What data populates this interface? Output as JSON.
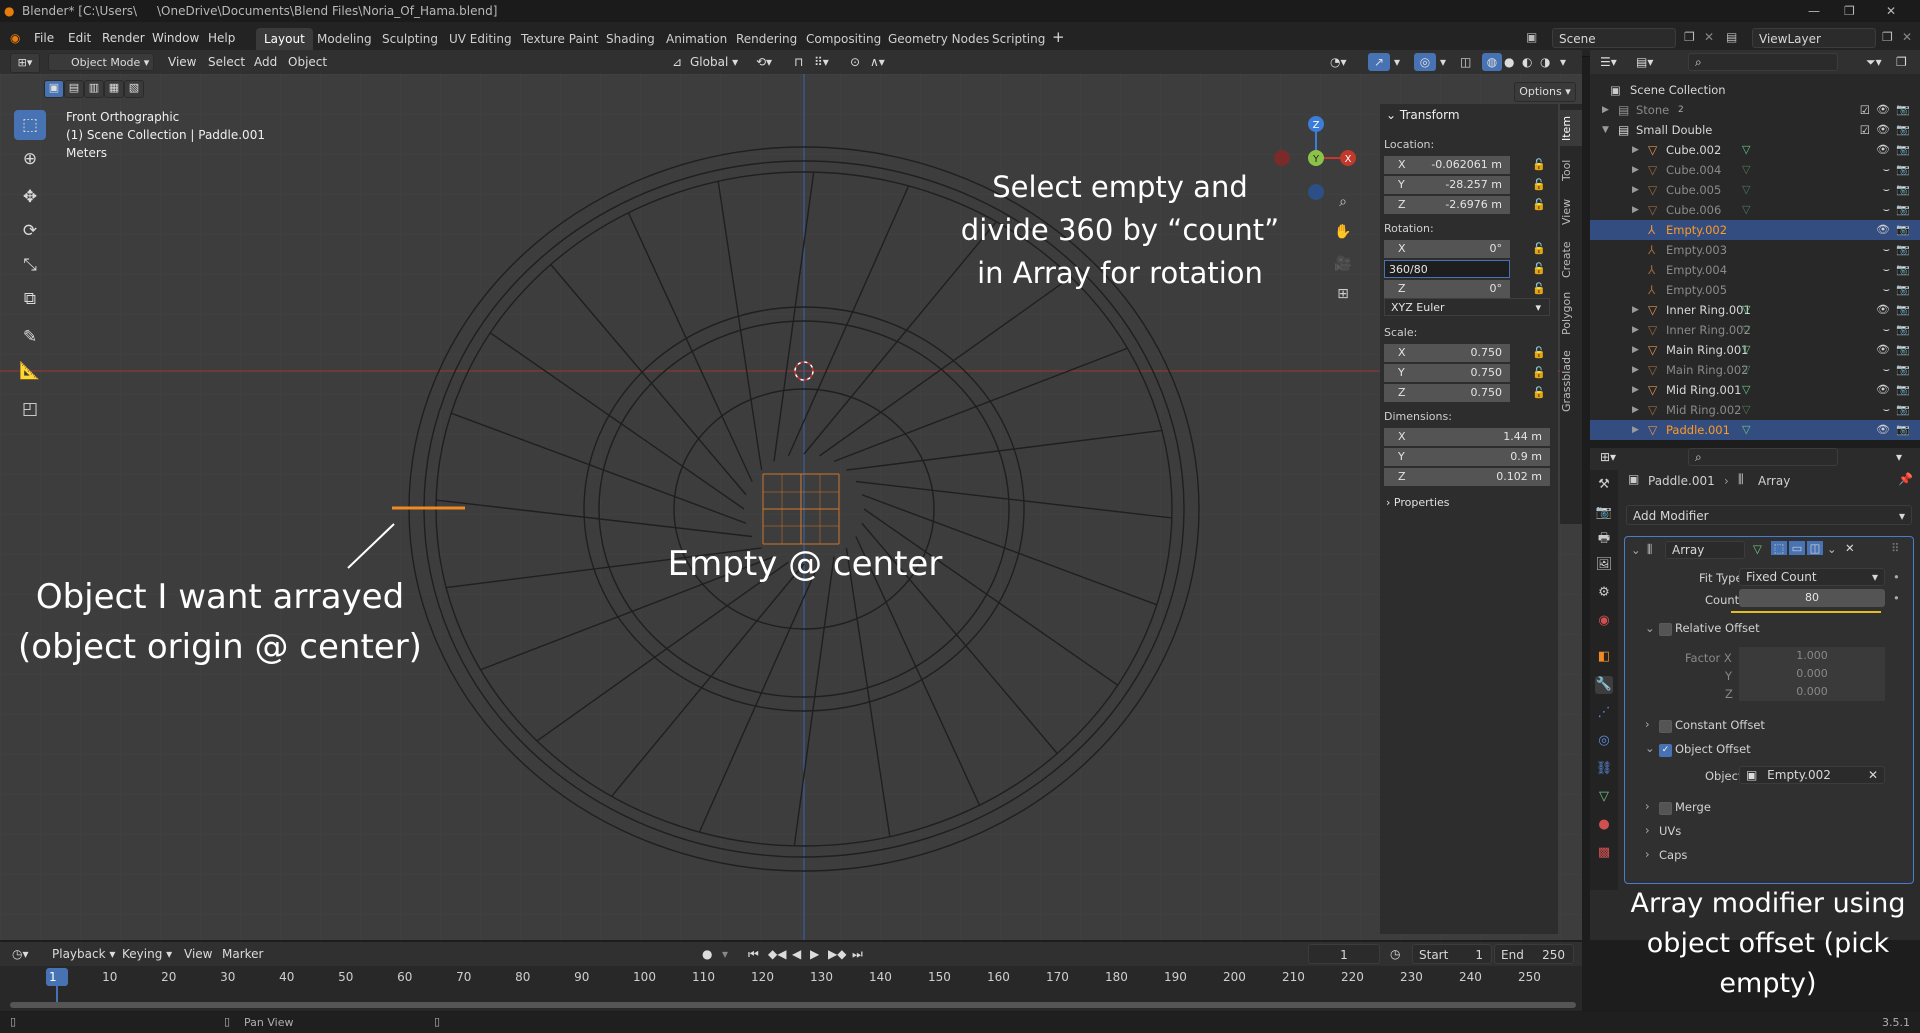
{
  "titlebar": {
    "title": "Blender* [C:\\Users\\",
    "path": "\\OneDrive\\Documents\\Blend Files\\Noria_Of_Hama.blend]"
  },
  "menu": {
    "items": [
      "File",
      "Edit",
      "Render",
      "Window",
      "Help"
    ]
  },
  "workspaces": [
    "Layout",
    "Modeling",
    "Sculpting",
    "UV Editing",
    "Texture Paint",
    "Shading",
    "Animation",
    "Rendering",
    "Compositing",
    "Geometry Nodes",
    "Scripting"
  ],
  "active_workspace": "Layout",
  "scene": "Scene",
  "viewlayer": "ViewLayer",
  "viewport_header": {
    "mode": "Object Mode",
    "items": [
      "View",
      "Select",
      "Add",
      "Object"
    ],
    "orientation": "Global",
    "options": "Options"
  },
  "viewport_info": {
    "view": "Front Orthographic",
    "collection": "(1) Scene Collection | Paddle.001",
    "units": "Meters"
  },
  "annotations": {
    "select_empty": "Select empty and divide 360 by “count” in Array for rotation",
    "empty_center": "Empty @ center",
    "object_arrayed": "Object I want arrayed (object origin @ center)",
    "array_modifier": "Array modifier using object offset (pick empty)"
  },
  "npanel": {
    "tabs": [
      "Item",
      "Tool",
      "View",
      "Create",
      "Polygon",
      "Grassblade"
    ],
    "transform_title": "Transform",
    "location_label": "Location:",
    "location": [
      {
        "axis": "X",
        "value": "-0.062061 m"
      },
      {
        "axis": "Y",
        "value": "-28.257 m"
      },
      {
        "axis": "Z",
        "value": "-2.6976 m"
      }
    ],
    "rotation_label": "Rotation:",
    "rotation": [
      {
        "axis": "X",
        "value": "0°"
      },
      {
        "axis": "",
        "value": "360/80"
      },
      {
        "axis": "Z",
        "value": "0°"
      }
    ],
    "rotation_mode": "XYZ Euler",
    "scale_label": "Scale:",
    "scale": [
      {
        "axis": "X",
        "value": "0.750"
      },
      {
        "axis": "Y",
        "value": "0.750"
      },
      {
        "axis": "Z",
        "value": "0.750"
      }
    ],
    "dimensions_label": "Dimensions:",
    "dimensions": [
      {
        "axis": "X",
        "value": "1.44 m"
      },
      {
        "axis": "Y",
        "value": "0.9 m"
      },
      {
        "axis": "Z",
        "value": "0.102 m"
      }
    ],
    "properties_label": "Properties"
  },
  "outliner": {
    "root": "Scene Collection",
    "rows": [
      {
        "name": "Stone",
        "indent": 1,
        "type": "collection",
        "dim": true,
        "badge": "2"
      },
      {
        "name": "Small Double",
        "indent": 1,
        "type": "collection",
        "dim": false
      },
      {
        "name": "Cube.002",
        "indent": 2,
        "type": "mesh",
        "dim": false,
        "visible": true
      },
      {
        "name": "Cube.004",
        "indent": 2,
        "type": "mesh",
        "dim": true
      },
      {
        "name": "Cube.005",
        "indent": 2,
        "type": "mesh",
        "dim": true
      },
      {
        "name": "Cube.006",
        "indent": 2,
        "type": "mesh",
        "dim": true
      },
      {
        "name": "Empty.002",
        "indent": 2,
        "type": "empty",
        "dim": false,
        "selected": true,
        "visible": true
      },
      {
        "name": "Empty.003",
        "indent": 2,
        "type": "empty",
        "dim": true
      },
      {
        "name": "Empty.004",
        "indent": 2,
        "type": "empty",
        "dim": true
      },
      {
        "name": "Empty.005",
        "indent": 2,
        "type": "empty",
        "dim": true
      },
      {
        "name": "Inner Ring.001",
        "indent": 2,
        "type": "mesh",
        "dim": false,
        "visible": true
      },
      {
        "name": "Inner Ring.002",
        "indent": 2,
        "type": "mesh",
        "dim": true
      },
      {
        "name": "Main Ring.001",
        "indent": 2,
        "type": "mesh",
        "dim": false,
        "visible": true
      },
      {
        "name": "Main Ring.002",
        "indent": 2,
        "type": "mesh",
        "dim": true
      },
      {
        "name": "Mid Ring.001",
        "indent": 2,
        "type": "mesh",
        "dim": false,
        "visible": true
      },
      {
        "name": "Mid Ring.002",
        "indent": 2,
        "type": "mesh",
        "dim": true
      },
      {
        "name": "Paddle.001",
        "indent": 2,
        "type": "mesh",
        "dim": false,
        "active": true,
        "visible": true
      }
    ]
  },
  "properties": {
    "breadcrumb_object": "Paddle.001",
    "breadcrumb_modifier": "Array",
    "add_modifier": "Add Modifier",
    "modifier_name": "Array",
    "fit_type_label": "Fit Type",
    "fit_type": "Fixed Count",
    "count_label": "Count",
    "count": "80",
    "relative_offset": "Relative Offset",
    "factor_x_label": "Factor X",
    "factor_x": "1.000",
    "factor_y_label": "Y",
    "factor_y": "0.000",
    "factor_z_label": "Z",
    "factor_z": "0.000",
    "constant_offset": "Constant Offset",
    "object_offset": "Object Offset",
    "object_label": "Object",
    "object_value": "Empty.002",
    "merge": "Merge",
    "uvs": "UVs",
    "caps": "Caps"
  },
  "timeline": {
    "menus": [
      "Playback",
      "Keying",
      "View",
      "Marker"
    ],
    "current_frame": "1",
    "start_label": "Start",
    "start": "1",
    "end_label": "End",
    "end": "250",
    "ruler": [
      "1",
      "10",
      "20",
      "30",
      "40",
      "50",
      "60",
      "70",
      "80",
      "90",
      "100",
      "110",
      "120",
      "130",
      "140",
      "150",
      "160",
      "170",
      "180",
      "190",
      "200",
      "210",
      "220",
      "230",
      "240",
      "250"
    ]
  },
  "status": {
    "hint": "Pan View",
    "version": "3.5.1"
  },
  "colors": {
    "accent": "#4772b3",
    "selected_object": "#ff9a22",
    "axis_x": "#c0392b",
    "axis_y": "#8bc34a",
    "axis_z": "#3b7dd8"
  }
}
